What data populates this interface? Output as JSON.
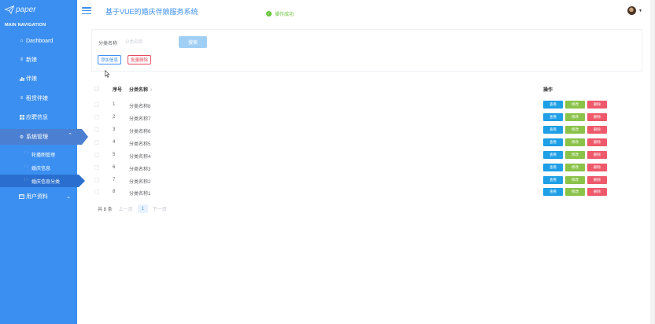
{
  "app": {
    "logo_text": "paper",
    "title": "基于VUE的婚庆伴娘服务系统"
  },
  "toast": {
    "message": "操作成功",
    "color": "#67c23a"
  },
  "sidebar": {
    "section_label": "MAIN NAVIGATION",
    "background": "#3b8ff0",
    "items": [
      {
        "label": "Dashboard",
        "icon": "home-icon"
      },
      {
        "label": "新娘",
        "icon": "list-icon"
      },
      {
        "label": "伴娘",
        "icon": "bar-chart-icon"
      },
      {
        "label": "租赁伴娘",
        "icon": "list-icon"
      },
      {
        "label": "应聘信息",
        "icon": "grid-icon"
      },
      {
        "label": "系统管理",
        "icon": "gear-icon",
        "expanded": true
      },
      {
        "label": "用户资料",
        "icon": "id-card-icon",
        "expanded": false
      }
    ],
    "sub_items": [
      {
        "label": "轮播图管理",
        "icon": "folder-icon"
      },
      {
        "label": "婚庆信息",
        "icon": "folder-icon"
      },
      {
        "label": "婚庆信息分类",
        "icon": "folder-icon",
        "active": true
      }
    ]
  },
  "search": {
    "label": "分类名称",
    "placeholder": "分类名称",
    "button_label": "搜索"
  },
  "actions": {
    "add_label": "添加信息",
    "batch_delete_label": "批量删除"
  },
  "table": {
    "headers": {
      "index": "序号",
      "name": "分类名称",
      "ops": "操作"
    },
    "rows": [
      {
        "index": "1",
        "name": "分类名称8"
      },
      {
        "index": "2",
        "name": "分类名称7"
      },
      {
        "index": "3",
        "name": "分类名称6"
      },
      {
        "index": "4",
        "name": "分类名称5"
      },
      {
        "index": "5",
        "name": "分类名称4"
      },
      {
        "index": "6",
        "name": "分类名称3"
      },
      {
        "index": "7",
        "name": "分类名称2"
      },
      {
        "index": "8",
        "name": "分类名称1"
      }
    ],
    "op_labels": {
      "view": "查看",
      "edit": "修改",
      "delete": "删除"
    },
    "op_colors": {
      "view": "#1e9fe6",
      "edit": "#8bc34a",
      "delete": "#ee5a6b"
    }
  },
  "pagination": {
    "total_text": "共 8 条",
    "prev": "上一页",
    "current": "1",
    "next": "下一页"
  }
}
